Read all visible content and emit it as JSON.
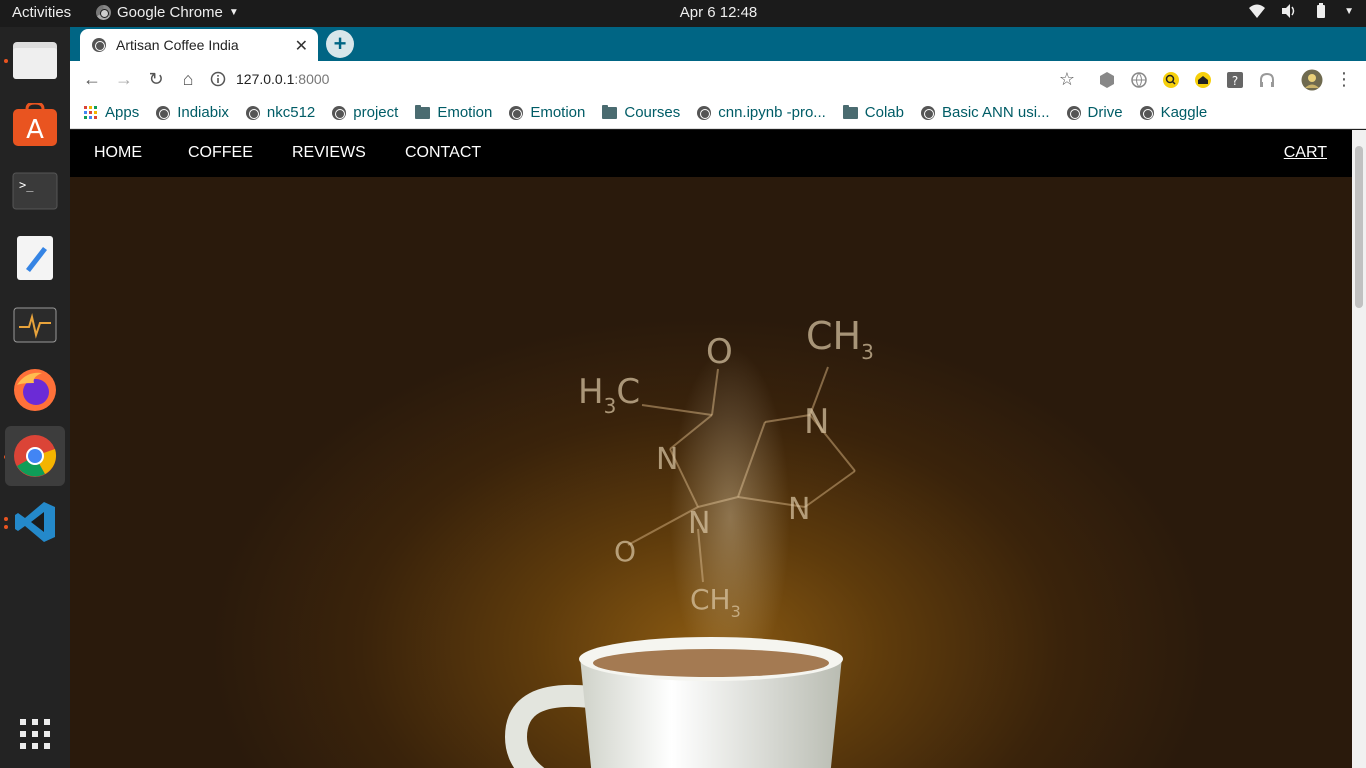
{
  "system": {
    "activities": "Activities",
    "app_name": "Google Chrome",
    "clock": "Apr 6  12:48"
  },
  "browser": {
    "tab_title": "Artisan Coffee India",
    "url_host": "127.0.0.1",
    "url_port": ":8000",
    "tab_color": "#006584"
  },
  "bookmarks": [
    {
      "label": "Apps",
      "icon": "apps-icon"
    },
    {
      "label": "Indiabix",
      "icon": "globe-icon"
    },
    {
      "label": "nkc512",
      "icon": "globe-icon"
    },
    {
      "label": "project",
      "icon": "globe-icon"
    },
    {
      "label": "Emotion",
      "icon": "folder-icon"
    },
    {
      "label": "Emotion",
      "icon": "globe-icon"
    },
    {
      "label": "Courses",
      "icon": "folder-icon"
    },
    {
      "label": "cnn.ipynb -pro...",
      "icon": "globe-icon"
    },
    {
      "label": "Colab",
      "icon": "folder-icon"
    },
    {
      "label": "Basic ANN usi...",
      "icon": "globe-icon"
    },
    {
      "label": "Drive",
      "icon": "globe-icon"
    },
    {
      "label": "Kaggle",
      "icon": "globe-icon"
    }
  ],
  "site": {
    "nav": {
      "home": "HOME",
      "coffee": "COFFEE",
      "reviews": "REVIEWS",
      "contact": "CONTACT",
      "cart": "CART"
    },
    "molecule": {
      "o_top": "O",
      "h3c": "H",
      "h3c_sub": "3",
      "h3c_c": "C",
      "ch3_top": "CH",
      "ch3_top_sub": "3",
      "n_left": "N",
      "n_right": "N",
      "n_bottom": "N",
      "n_mid": "N",
      "o_bottom": "O",
      "ch3_bottom": "CH",
      "ch3_bottom_sub": "3"
    }
  }
}
